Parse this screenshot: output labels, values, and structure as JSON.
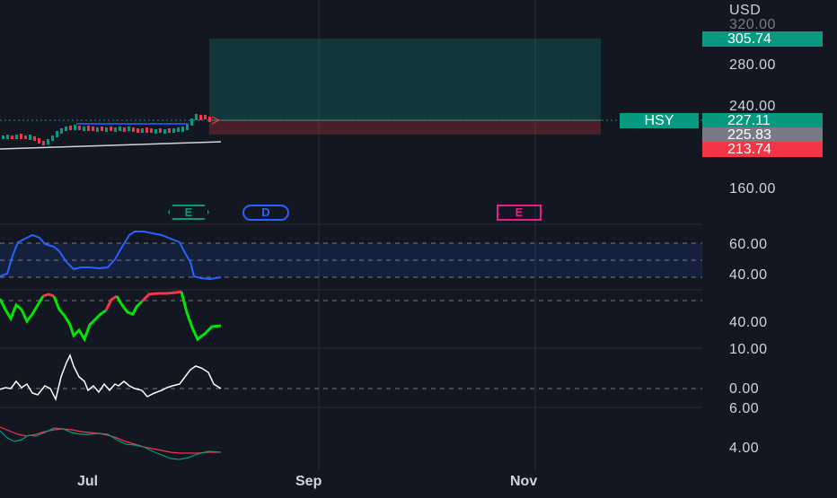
{
  "price_axis": {
    "currency": "USD",
    "ticks": [
      "320.00",
      "280.00",
      "240.00",
      "160.00"
    ]
  },
  "price_badges": {
    "target": "305.74",
    "current": "227.11",
    "entry": "225.83",
    "stop": "213.74"
  },
  "symbol": "HSY",
  "events": [
    "E",
    "D",
    "E"
  ],
  "indicator_axes": {
    "pane1": [
      "60.00",
      "40.00"
    ],
    "pane2": [
      "40.00"
    ],
    "pane3": [
      "10.00",
      "0.00"
    ],
    "pane4": [
      "6.00",
      "4.00"
    ]
  },
  "time_axis": [
    "Jul",
    "Sep",
    "Nov"
  ],
  "colors": {
    "bg": "#131722",
    "up": "#089981",
    "down": "#f23645",
    "neutral": "#787b86",
    "blue": "#2962ff",
    "magenta": "#e91e8c"
  }
}
